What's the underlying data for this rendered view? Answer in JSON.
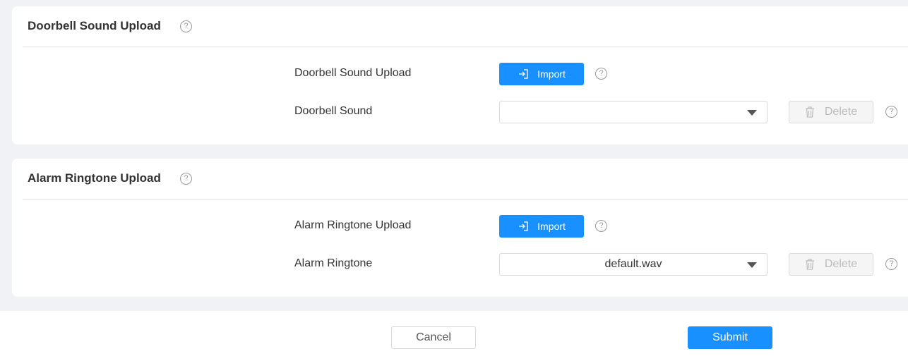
{
  "sections": [
    {
      "title": "Doorbell Sound Upload",
      "upload_label": "Doorbell Sound Upload",
      "import_label": "Import",
      "select_label": "Doorbell Sound",
      "select_value": "",
      "delete_label": "Delete"
    },
    {
      "title": "Alarm Ringtone Upload",
      "upload_label": "Alarm Ringtone Upload",
      "import_label": "Import",
      "select_label": "Alarm Ringtone",
      "select_value": "default.wav",
      "delete_label": "Delete"
    }
  ],
  "footer": {
    "cancel_label": "Cancel",
    "submit_label": "Submit"
  },
  "colors": {
    "primary": "#1890ff",
    "background": "#f0f2f5"
  },
  "help_glyph": "?"
}
